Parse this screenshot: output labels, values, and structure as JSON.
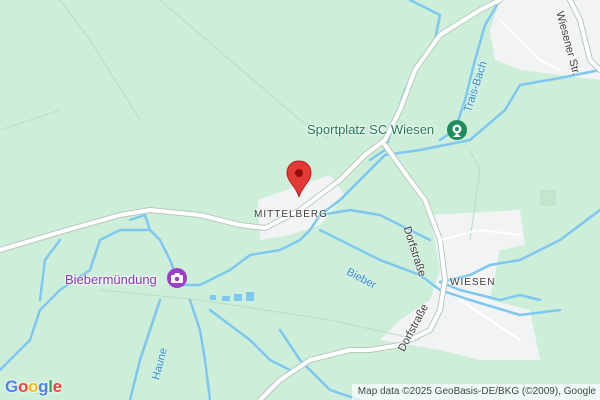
{
  "map": {
    "labels": {
      "mittelberg": "MITTELBERG",
      "wiesen": "WIESEN",
      "dorfstrasse_upper": "Dorfstraße",
      "dorfstrasse_lower": "Dorfstraße",
      "wiesener_str": "Wiesener Str.",
      "trais_bach": "Trais-Bach",
      "bieber": "Bieber",
      "haune": "Haune"
    },
    "pois": {
      "sportplatz": {
        "label": "Sportplatz SC Wiesen",
        "icon": "sports-facility-icon",
        "color": "#1f8c5c"
      },
      "biebermuendung": {
        "label": "Biebermündung",
        "icon": "camera-tourist-icon",
        "color": "#9b3fc6"
      }
    },
    "marker": {
      "icon": "red-location-pin-icon",
      "color": "#e53935"
    },
    "attribution": "Map data ©2025 GeoBasis-DE/BKG (©2009), Google",
    "logo": {
      "letters": [
        "G",
        "o",
        "o",
        "g",
        "l",
        "e"
      ],
      "colors": [
        "#4285F4",
        "#EA4335",
        "#FBBC05",
        "#4285F4",
        "#34A853",
        "#EA4335"
      ]
    },
    "colors": {
      "land": "#cdeed9",
      "water": "#7ec8f0",
      "road": "#ffffff",
      "road_outline": "#b9c9c1",
      "built_up": "#f1f3f4"
    }
  }
}
